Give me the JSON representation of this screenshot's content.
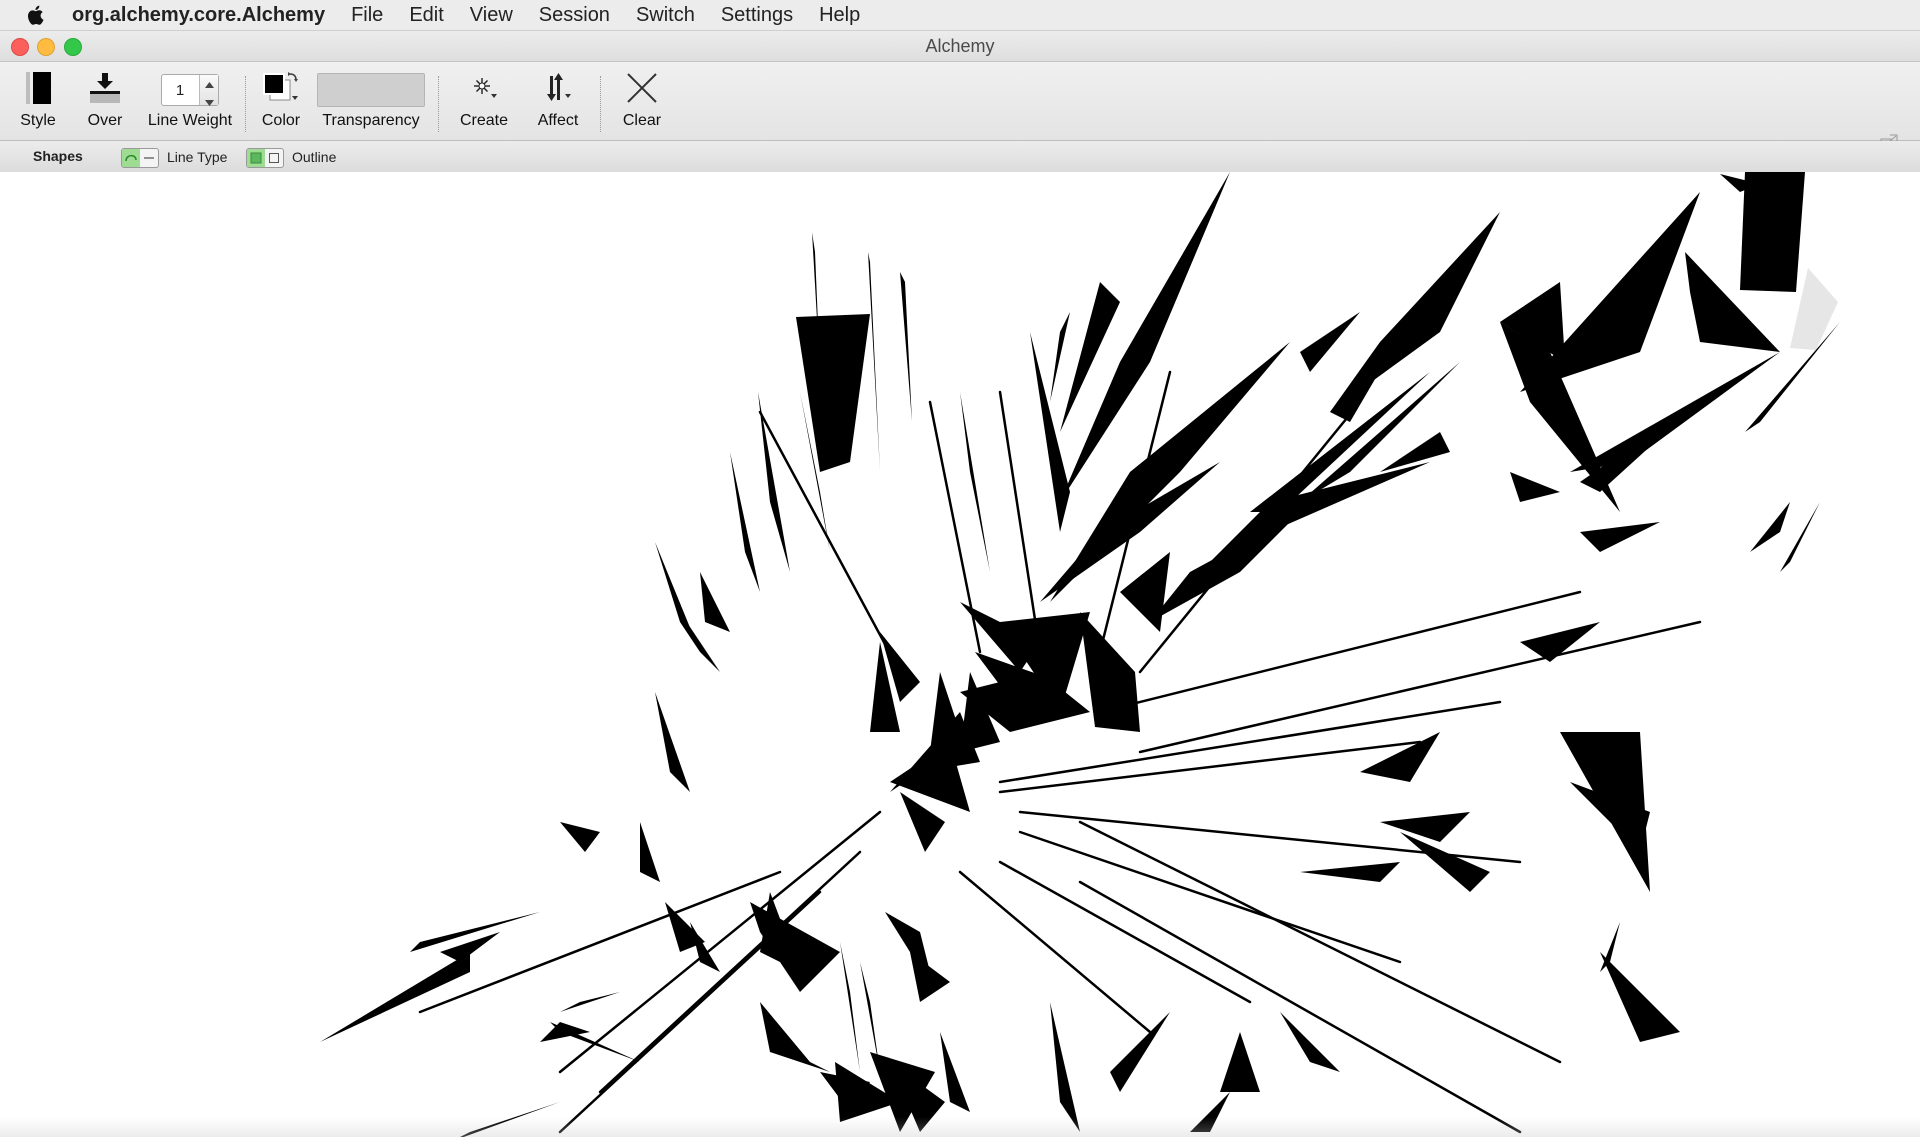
{
  "menubar": {
    "app_name": "org.alchemy.core.Alchemy",
    "items": [
      "File",
      "Edit",
      "View",
      "Session",
      "Switch",
      "Settings",
      "Help"
    ]
  },
  "window": {
    "title": "Alchemy"
  },
  "toolbar": {
    "style_label": "Style",
    "over_label": "Over",
    "line_weight_label": "Line Weight",
    "line_weight_value": "1",
    "color_label": "Color",
    "transparency_label": "Transparency",
    "create_label": "Create",
    "affect_label": "Affect",
    "clear_label": "Clear"
  },
  "subbar": {
    "shapes_label": "Shapes",
    "line_type_label": "Line Type",
    "outline_label": "Outline"
  },
  "colors": {
    "current_color": "#000000",
    "toggle_active": "#9edc93",
    "canvas_background": "#ffffff"
  },
  "icons": {
    "apple": "apple-logo-icon",
    "style": "style-swatch-icon",
    "over": "download-arrow-icon",
    "color": "color-swap-icon",
    "create": "sparkle-create-icon",
    "affect": "affect-arrows-icon",
    "clear": "x-close-icon",
    "expand": "fullscreen-toggle-icon"
  }
}
